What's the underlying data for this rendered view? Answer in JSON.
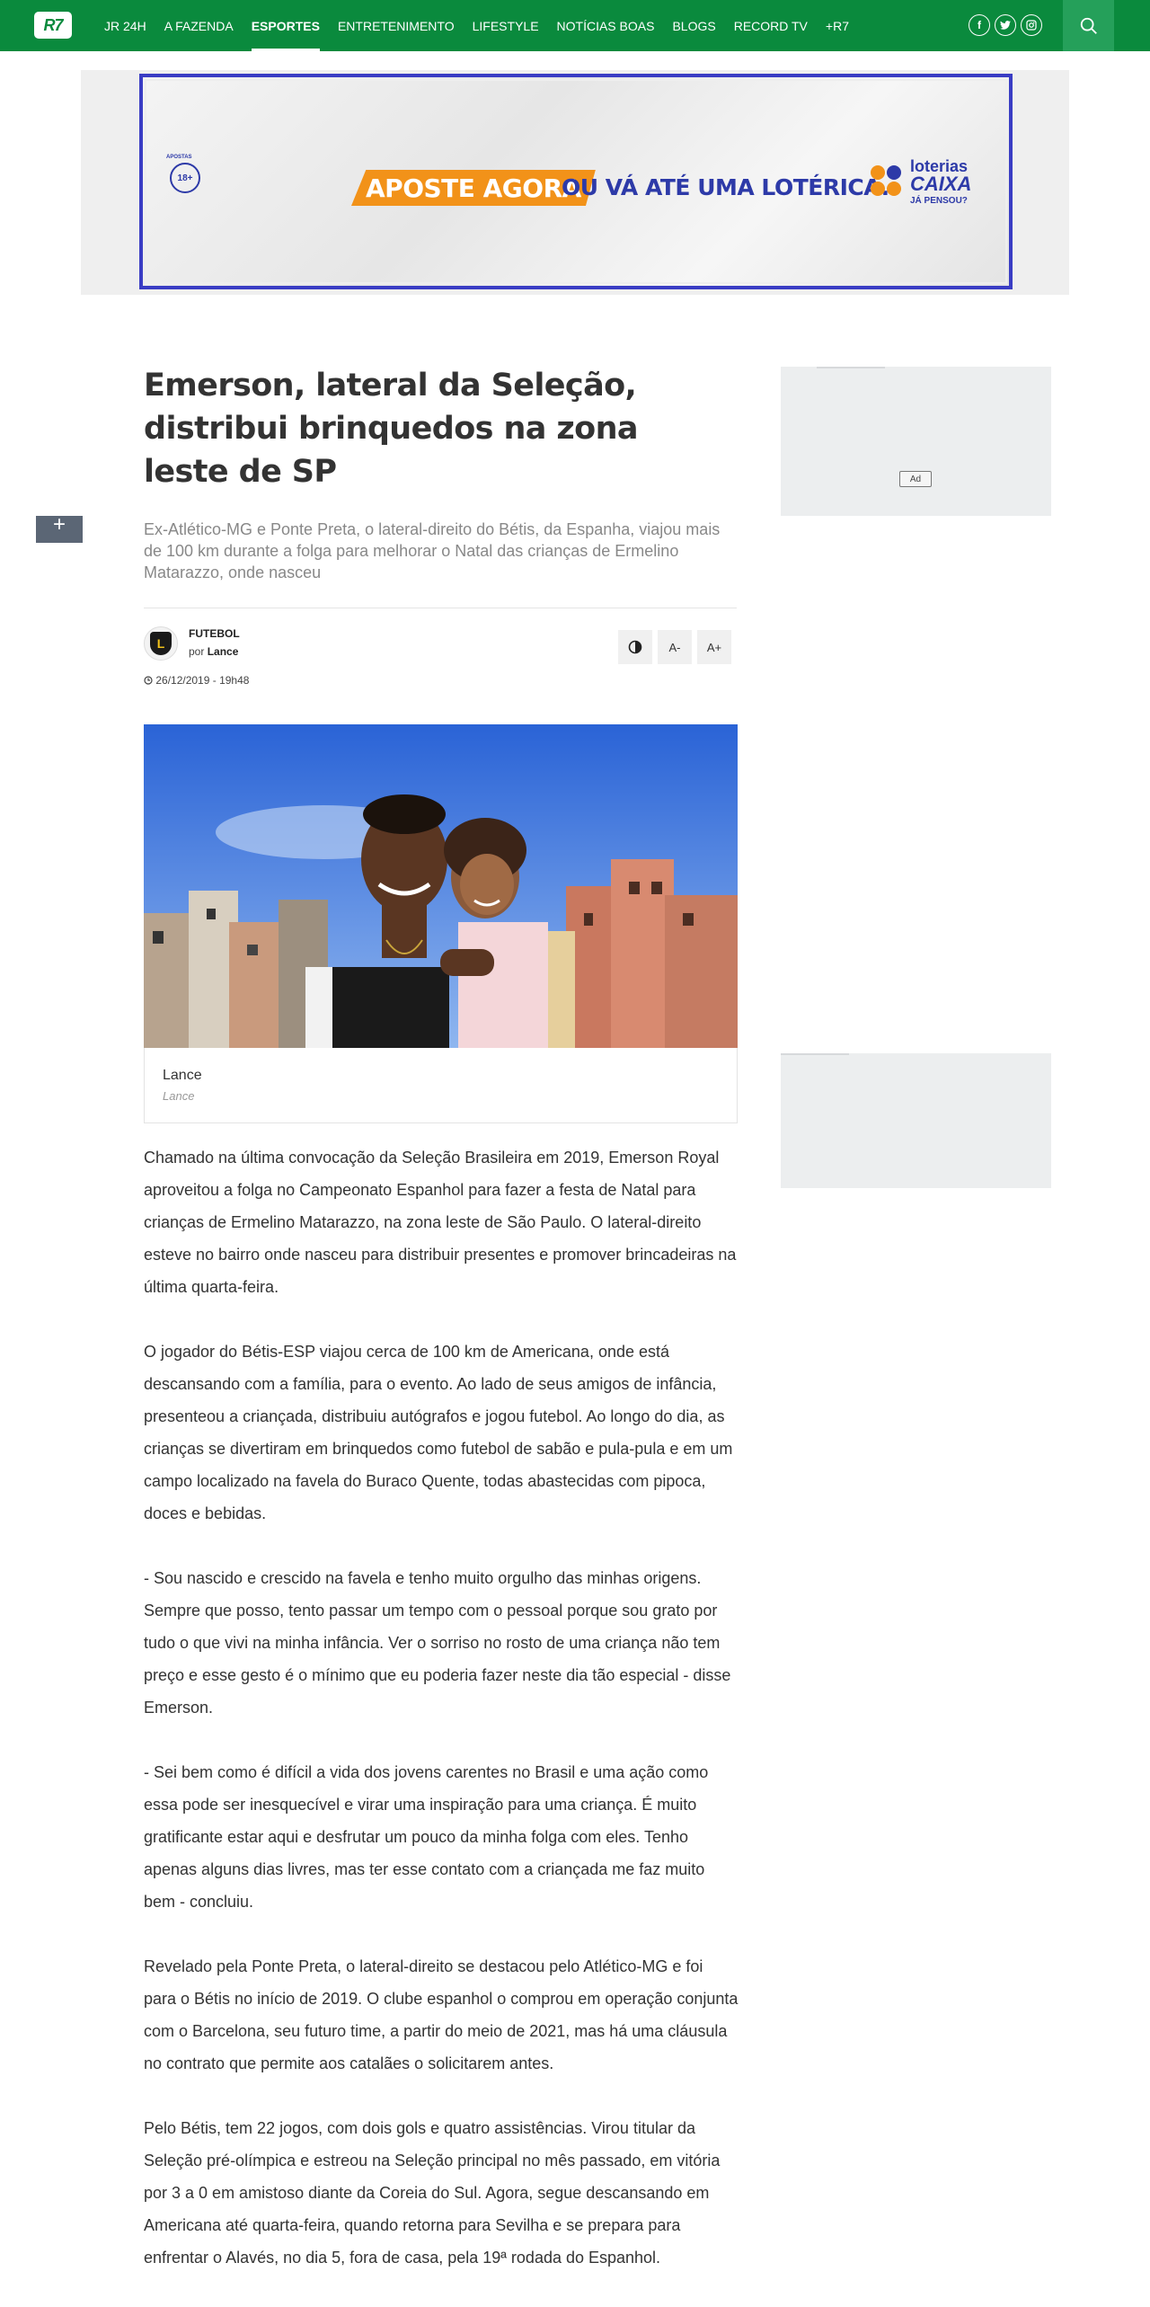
{
  "header": {
    "logo": "R7",
    "nav": [
      "JR 24H",
      "A FAZENDA",
      "ESPORTES",
      "ENTRETENIMENTO",
      "LIFESTYLE",
      "NOTÍCIAS BOAS",
      "BLOGS",
      "RECORD TV",
      "+R7"
    ],
    "active_index": 2,
    "socials": [
      "facebook-icon",
      "twitter-icon",
      "instagram-icon"
    ],
    "search_icon": "search-icon",
    "brand_color": "#0a8a3d"
  },
  "banner": {
    "aposte": "APOSTE AGORA",
    "ou_va": "OU VÁ ATÉ UMA LOTÉRICA.",
    "age": "18+",
    "age_top": "APOSTAS",
    "loterias_1": "loterias",
    "loterias_2": "CAIXA",
    "loterias_3": "JÁ PENSOU?"
  },
  "article": {
    "title": "Emerson, lateral da Seleção, distribui brinquedos na zona leste de SP",
    "subtitle": "Ex-Atlético-MG e Ponte Preta, o lateral-direito do Bétis, da Espanha, viajou mais de 100 km durante a folga para melhorar o Natal das crianças de Ermelino Matarazzo, onde nasceu",
    "category": "FUTEBOL",
    "by_prefix": "por",
    "author": "Lance",
    "date": "26/12/2019 - 19h48",
    "tools": {
      "contrast": "◐",
      "decrease": "A-",
      "increase": "A+"
    },
    "share": "+",
    "photo_caption": "Lance",
    "photo_credit": "Lance",
    "paragraphs": [
      "Chamado na última convocação da Seleção Brasileira em 2019, Emerson Royal aproveitou a folga no Campeonato Espanhol para fazer a festa de Natal para crianças de Ermelino Matarazzo, na zona leste de São Paulo. O lateral-direito esteve no bairro onde nasceu para distribuir presentes e promover brincadeiras na última quarta-feira.",
      "O jogador do Bétis-ESP viajou cerca de 100 km de Americana, onde está descansando com a família, para o evento. Ao lado de seus amigos de infância, presenteou a criançada, distribuiu autógrafos e jogou futebol. Ao longo do dia, as crianças se divertiram em brinquedos como futebol de sabão e pula-pula e em um campo localizado na favela do Buraco Quente, todas abastecidas com pipoca, doces e bebidas.",
      "- Sou nascido e crescido na favela e tenho muito orgulho das minhas origens. Sempre que posso, tento passar um tempo com o pessoal porque sou grato por tudo o que vivi na minha infância. Ver o sorriso no rosto de uma criança não tem preço e esse gesto é o mínimo que eu poderia fazer neste dia tão especial - disse Emerson.",
      "- Sei bem como é difícil a vida dos jovens carentes no Brasil e uma ação como essa pode ser inesquecível e virar uma inspiração para uma criança. É muito gratificante estar aqui e desfrutar um pouco da minha folga com eles. Tenho apenas alguns dias livres, mas ter esse contato com a criançada me faz muito bem - concluiu.",
      "Revelado pela Ponte Preta, o lateral-direito se destacou pelo Atlético-MG e foi para o Bétis no início de 2019. O clube espanhol o comprou em operação conjunta com o Barcelona, seu futuro time, a partir do meio de 2021, mas há uma cláusula no contrato que permite aos catalães o solicitarem antes.",
      "Pelo Bétis, tem 22 jogos, com dois gols e quatro assistências. Virou titular da Seleção pré-olímpica e estreou na Seleção principal no mês passado, em vitória por 3 a 0 em amistoso diante da Coreia do Sul. Agora, segue descansando em Americana até quarta-feira, quando retorna para Sevilha e se prepara para enfrentar o Alavés, no dia 5, fora de casa, pela 19ª rodada do Espanhol."
    ]
  },
  "sidebar": {
    "ad_label": "Ad"
  }
}
